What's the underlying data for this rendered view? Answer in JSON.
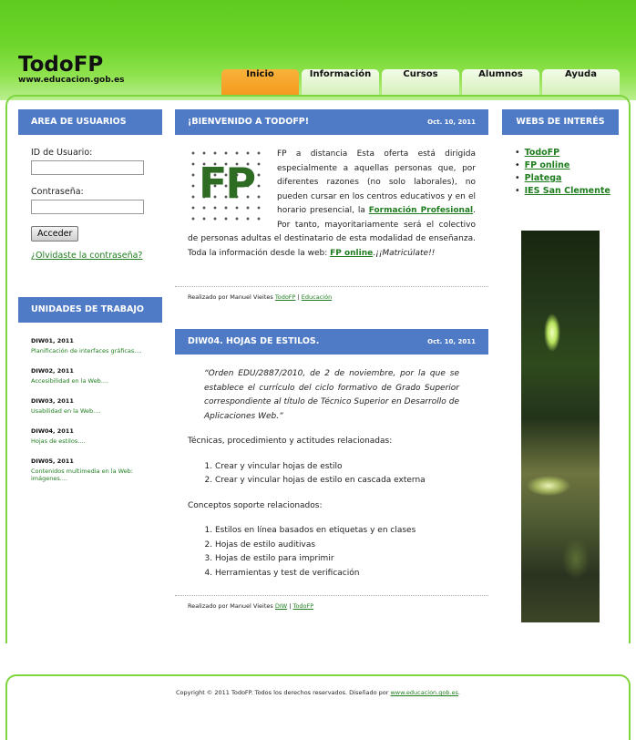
{
  "site": {
    "title": "TodoFP",
    "url": "www.educacion.gob.es"
  },
  "nav": {
    "tabs": [
      "Inicio",
      "Información",
      "Cursos",
      "Alumnos",
      "Ayuda"
    ],
    "active": "Inicio"
  },
  "user_area": {
    "heading": "AREA DE USUARIOS",
    "user_label": "ID de Usuario:",
    "user_value": "",
    "password_label": "Contraseña:",
    "password_value": "",
    "submit_label": "Acceder",
    "forgot_label": "¿Olvidaste la contraseña?"
  },
  "units": {
    "heading": "UNIDADES DE TRABAJO",
    "items": [
      {
        "title": "DIW01, 2011",
        "link": "Planificación de interfaces gráficas...."
      },
      {
        "title": "DIW02, 2011",
        "link": "Accesibilidad en la Web...."
      },
      {
        "title": "DIW03, 2011",
        "link": "Usabilidad en la Web...."
      },
      {
        "title": "DIW04, 2011",
        "link": "Hojas de estilos...."
      },
      {
        "title": "DIW05, 2011",
        "link": "Contenidos multimedia en la Web: imágenes...."
      }
    ]
  },
  "post1": {
    "title": "¡BIENVENIDO A TODOFP!",
    "date": "Oct. 10, 2011",
    "logo_text": "FP",
    "text_a": "FP a distancia Esta oferta está dirigida especialmente a aquellas personas que, por diferentes razones (no solo laborales), no pueden cursar en los centros educativos y en el horario presencial, la ",
    "link_a": "Formación Profesional",
    "text_b": ". Por tanto, mayoritariamente será el colectivo de personas adultas el destinatario de esta modalidad de enseñanza. Toda la información desde la web: ",
    "link_b": "FP online",
    "text_c": ".",
    "text_c_italic": "¡¡Matricúlate!!",
    "footer_by": "Realizado por Manuel Vieites",
    "footer_links": [
      "TodoFP",
      "Educación"
    ]
  },
  "post2": {
    "title": "DIW04. HOJAS DE ESTILOS.",
    "date": "Oct. 10, 2011",
    "quote": "“Orden EDU/2887/2010, de 2 de noviembre, por la que se establece el currículo del ciclo formativo de Grado Superior correspondiente al título de Técnico Superior en Desarrollo de Aplicaciones Web.”",
    "section1_title": "Técnicas, procedimiento y actitudes relacionadas:",
    "section1_items": [
      "Crear y vincular hojas de estilo",
      "Crear y vincular hojas de estilo en cascada externa"
    ],
    "section2_title": "Conceptos soporte relacionados:",
    "section2_items": [
      "Estilos en línea basados en etiquetas y en clases",
      "Hojas de estilo auditivas",
      "Hojas de estilo para imprimir",
      "Herramientas y test de verificación"
    ],
    "footer_by": "Realizado por Manuel Vieites",
    "footer_links": [
      "DIW",
      "TodoFP"
    ]
  },
  "webs": {
    "heading": "WEBS DE INTERÉS",
    "links": [
      "TodoFP",
      "FP online",
      "Platega",
      "IES San Clemente"
    ]
  },
  "footer": {
    "text": "Copyright © 2011 TodoFP. Todos los derechos reservados. Diseñado por ",
    "link": "www.educacion.gob.es",
    "end": "."
  }
}
